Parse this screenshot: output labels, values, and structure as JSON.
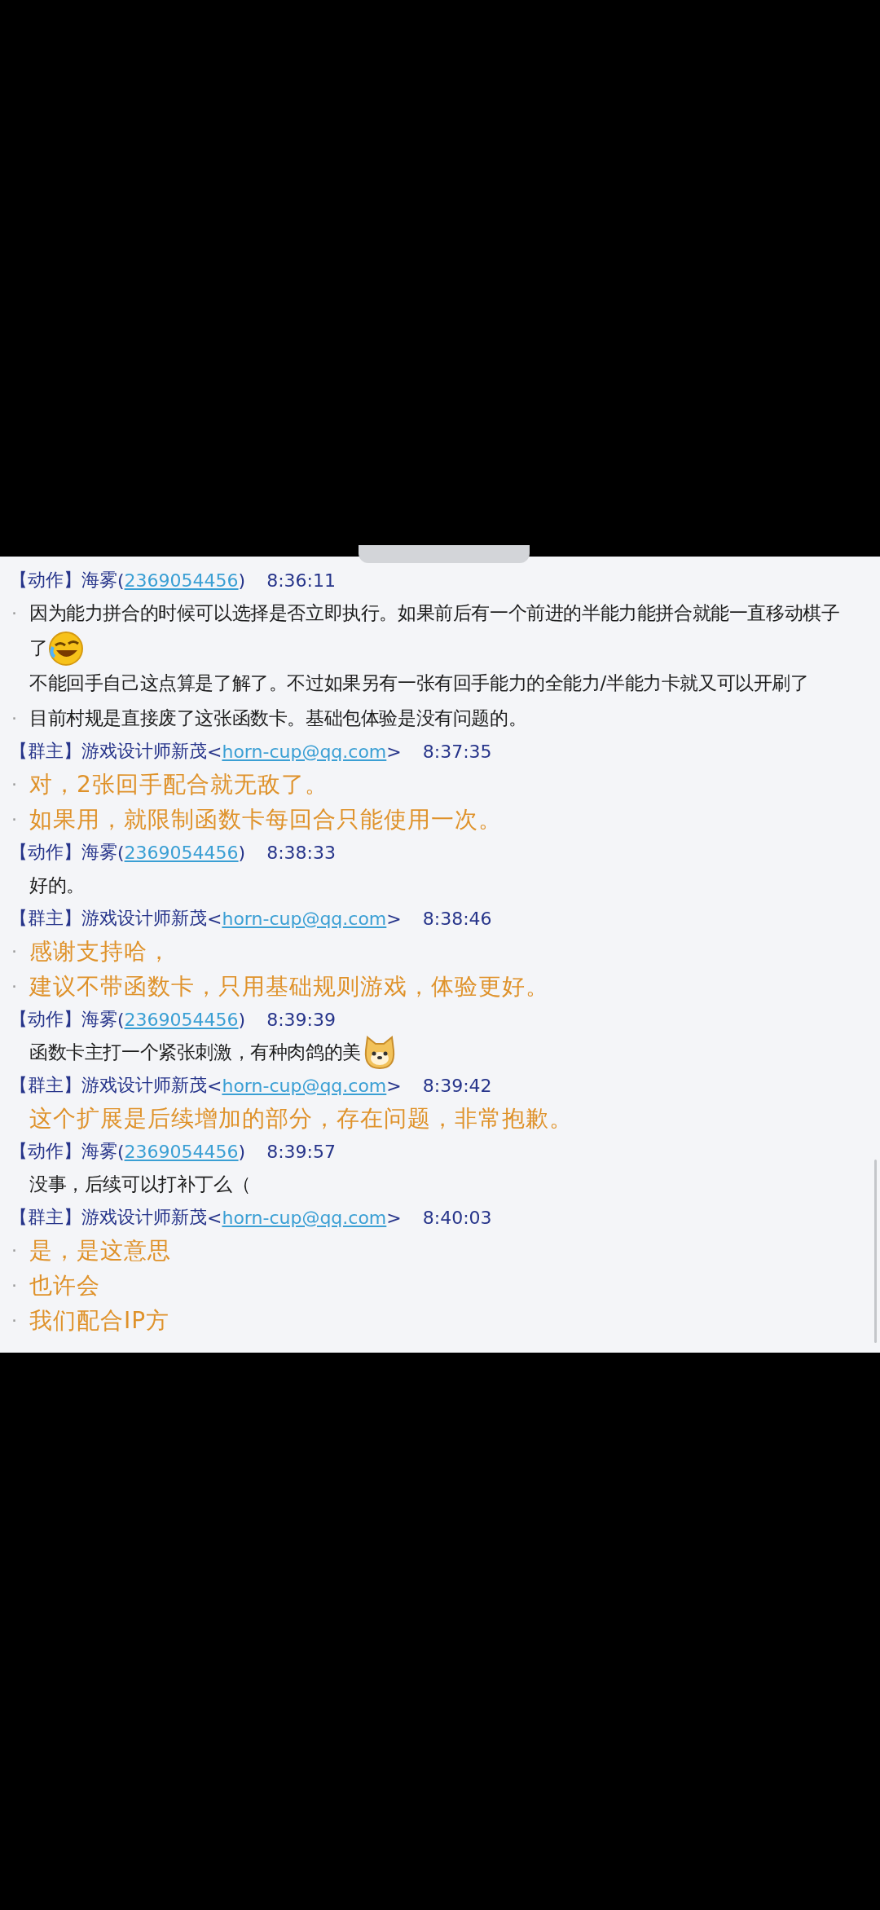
{
  "messages": [
    {
      "role": "【动作】",
      "name": "海雾",
      "open": "(",
      "contact": "2369054456",
      "close": ")",
      "time": "8:36:11",
      "lines": [
        {
          "kind": "plain",
          "bullet": "·",
          "text": "因为能力拼合的时候可以选择是否立即执行。如果前后有一个前进的半能力能拼合就能一直移动棋子"
        },
        {
          "kind": "plain",
          "text": "了",
          "emoji": {
            "kind": "laughing"
          }
        },
        {
          "kind": "plain",
          "text": "不能回手自己这点算是了解了。不过如果另有一张有回手能力的全能力/半能力卡就又可以开刷了"
        },
        {
          "kind": "plain",
          "bullet": "·",
          "text": "目前村规是直接废了这张函数卡。基础包体验是没有问题的。"
        }
      ]
    },
    {
      "role": "【群主】",
      "name": "游戏设计师新茂",
      "open": "<",
      "contact": "horn-cup@qq.com",
      "close": ">",
      "time": "8:37:35",
      "lines": [
        {
          "kind": "highlight",
          "bullet": "·",
          "text": "对，2张回手配合就无敌了。"
        },
        {
          "kind": "highlight",
          "bullet": "·",
          "text": "如果用，就限制函数卡每回合只能使用一次。"
        }
      ]
    },
    {
      "role": "【动作】",
      "name": "海雾",
      "open": "(",
      "contact": "2369054456",
      "close": ")",
      "time": "8:38:33",
      "lines": [
        {
          "kind": "plain",
          "text": "好的。"
        }
      ]
    },
    {
      "role": "【群主】",
      "name": "游戏设计师新茂",
      "open": "<",
      "contact": "horn-cup@qq.com",
      "close": ">",
      "time": "8:38:46",
      "lines": [
        {
          "kind": "highlight",
          "bullet": "·",
          "text": "感谢支持哈，"
        },
        {
          "kind": "highlight",
          "bullet": "·",
          "text": "建议不带函数卡，只用基础规则游戏，体验更好。"
        }
      ]
    },
    {
      "role": "【动作】",
      "name": "海雾",
      "open": "(",
      "contact": "2369054456",
      "close": ")",
      "time": "8:39:39",
      "lines": [
        {
          "kind": "plain",
          "text": "函数卡主打一个紧张刺激，有种肉鸽的美",
          "emoji": {
            "kind": "dog"
          }
        }
      ]
    },
    {
      "role": "【群主】",
      "name": "游戏设计师新茂",
      "open": "<",
      "contact": "horn-cup@qq.com",
      "close": ">",
      "time": "8:39:42",
      "lines": [
        {
          "kind": "highlight",
          "text": "这个扩展是后续增加的部分，存在问题，非常抱歉。"
        }
      ]
    },
    {
      "role": "【动作】",
      "name": "海雾",
      "open": "(",
      "contact": "2369054456",
      "close": ")",
      "time": "8:39:57",
      "lines": [
        {
          "kind": "plain",
          "text": "没事，后续可以打补丁么（"
        }
      ]
    },
    {
      "role": "【群主】",
      "name": "游戏设计师新茂",
      "open": "<",
      "contact": "horn-cup@qq.com",
      "close": ">",
      "time": "8:40:03",
      "lines": [
        {
          "kind": "highlight",
          "bullet": "·",
          "text": "是，是这意思"
        },
        {
          "kind": "highlight",
          "bullet": "·",
          "text": "也许会"
        },
        {
          "kind": "highlight",
          "bullet": "·",
          "text": "我们配合IP方"
        }
      ]
    }
  ]
}
